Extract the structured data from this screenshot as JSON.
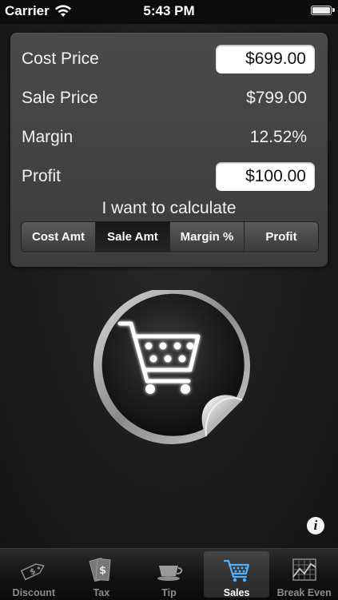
{
  "status_bar": {
    "carrier": "Carrier",
    "time": "5:43 PM"
  },
  "calculator": {
    "fields": [
      {
        "label": "Cost Price",
        "value": "$699.00",
        "editable": true
      },
      {
        "label": "Sale Price",
        "value": "$799.00",
        "editable": false
      },
      {
        "label": "Margin",
        "value": "12.52%",
        "editable": false
      },
      {
        "label": "Profit",
        "value": "$100.00",
        "editable": true
      }
    ],
    "calc_title": "I want to calculate",
    "segments": [
      {
        "label": "Cost Amt",
        "selected": false
      },
      {
        "label": "Sale Amt",
        "selected": true
      },
      {
        "label": "Margin %",
        "selected": false
      },
      {
        "label": "Profit",
        "selected": false
      }
    ]
  },
  "badge": {
    "icon": "shopping-cart-icon"
  },
  "info_button": {
    "glyph": "i"
  },
  "tabs": [
    {
      "label": "Discount",
      "icon": "price-tag-icon",
      "selected": false
    },
    {
      "label": "Tax",
      "icon": "money-bills-icon",
      "selected": false
    },
    {
      "label": "Tip",
      "icon": "coffee-cup-icon",
      "selected": false
    },
    {
      "label": "Sales",
      "icon": "shopping-cart-icon",
      "selected": true
    },
    {
      "label": "Break Even",
      "icon": "chart-icon",
      "selected": false
    }
  ],
  "colors": {
    "selected_tab_icon": "#4fb1ff",
    "panel": "#444445",
    "background": "#1c1c1d"
  }
}
